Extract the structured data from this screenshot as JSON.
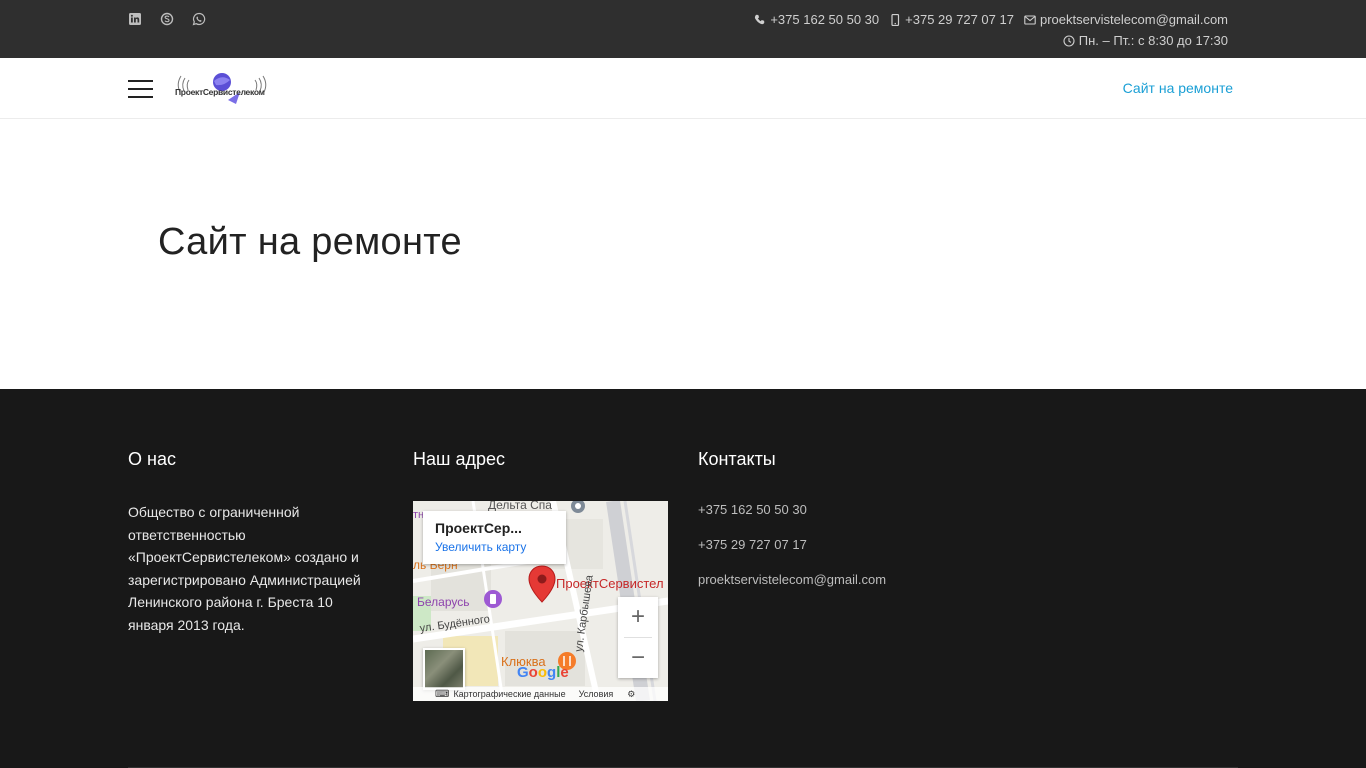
{
  "topbar": {
    "social_icons": [
      "linkedin-icon",
      "skype-icon",
      "whatsapp-icon"
    ],
    "phone1": "+375 162 50 50 30",
    "phone2": "+375 29 727 07 17",
    "email": "proektservistelecom@gmail.com",
    "hours": "Пн. – Пт.: с 8:30 до 17:30"
  },
  "header": {
    "logo_text": "ПроектСервистелеком",
    "nav_link": "Сайт на ремонте"
  },
  "main": {
    "title": "Сайт на ремонте"
  },
  "footer": {
    "about_title": "О нас",
    "about_text": "Общество с ограниченной ответственностью «ПроектСервистелеком» создано и зарегистрировано Администрацией Ленинского района г. Бреста 10 января 2013 года.",
    "address_title": "Наш адрес",
    "contacts_title": "Контакты",
    "contacts": [
      "+375 162 50 50 30",
      "+375 29 727 07 17",
      "proektservistelecom@gmail.com"
    ]
  },
  "map": {
    "card_title": "ПроектСер...",
    "card_link": "Увеличить карту",
    "place_label": "ПроектСервистел",
    "labels": {
      "delta": "Дельта Спа",
      "vern": "ль Верн",
      "belarus": "Беларусь",
      "budennogo": "ул. Будённого",
      "karbysheva": "ул. Карбышева",
      "klukva": "Клюква",
      "letter": "тн",
      "google": "Google"
    },
    "zoom_in": "+",
    "zoom_out": "−",
    "bottom_data": "Картографические данные",
    "bottom_terms": "Условия",
    "colors": {
      "pin": "#e53935",
      "link": "#1a73e8",
      "road": "#ffffff"
    }
  },
  "colors": {
    "topbar_bg": "#2f2f2f",
    "footer_bg": "#181818",
    "accent": "#1a9fd5"
  }
}
